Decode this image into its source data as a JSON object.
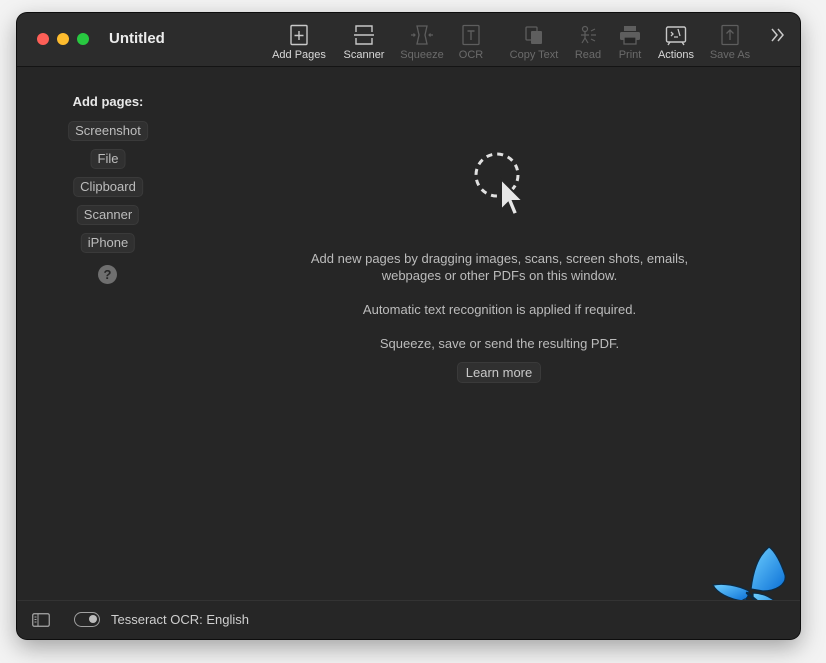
{
  "window": {
    "title": "Untitled"
  },
  "toolbar": {
    "items": [
      {
        "label": "Add Pages",
        "icon": "add-pages-icon",
        "enabled": true
      },
      {
        "label": "Scanner",
        "icon": "scanner-icon",
        "enabled": true
      },
      {
        "label": "Squeeze",
        "icon": "squeeze-icon",
        "enabled": false
      },
      {
        "label": "OCR",
        "icon": "ocr-icon",
        "enabled": false
      },
      {
        "label": "Copy Text",
        "icon": "copy-text-icon",
        "enabled": false
      },
      {
        "label": "Read",
        "icon": "read-icon",
        "enabled": false
      },
      {
        "label": "Print",
        "icon": "print-icon",
        "enabled": false
      },
      {
        "label": "Actions",
        "icon": "actions-icon",
        "enabled": true
      },
      {
        "label": "Save As",
        "icon": "save-as-icon",
        "enabled": false
      }
    ],
    "overflow_icon": "chevron-double-right-icon"
  },
  "sidebar": {
    "heading": "Add pages:",
    "sources": [
      "Screenshot",
      "File",
      "Clipboard",
      "Scanner",
      "iPhone"
    ],
    "help_label": "?"
  },
  "main": {
    "drop_icon": "drag-cursor-icon",
    "instruction_line1": "Add new pages by dragging images, scans, screen shots, emails,",
    "instruction_line2": "webpages or other PDFs on this window.",
    "ocr_note": "Automatic text recognition is applied if required.",
    "squeeze_note": "Squeeze, save or send the resulting PDF.",
    "learn_more": "Learn more",
    "logo": "butterfly-logo"
  },
  "statusbar": {
    "sidebar_icon": "sidebar-toggle-icon",
    "ocr_toggle_on": true,
    "ocr_label": "Tesseract OCR: English"
  },
  "colors": {
    "window_bg": "#262626",
    "titlebar_bg": "#2c2c2c",
    "close": "#fe5f57",
    "minimize": "#febc2e",
    "maximize": "#28c840",
    "butterfly_blue": "#1e9fff"
  }
}
